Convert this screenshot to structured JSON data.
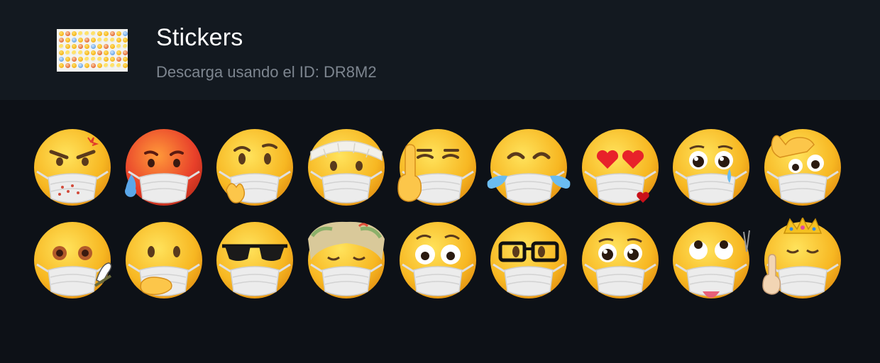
{
  "pack": {
    "title": "Stickers",
    "subtitle": "Descarga usando el ID: DR8M2",
    "thumbnail_icon": "sticker-sheet-thumbnail"
  },
  "colors": {
    "background": "#0d1117",
    "header_background": "#131920",
    "title": "#ffffff",
    "subtitle": "#7d858f",
    "face": "#f7b722",
    "mask": "#eeeeee"
  },
  "stickers": [
    {
      "icon": "angry-face-masked-icon",
      "variant": "angry"
    },
    {
      "icon": "hot-sweat-face-masked-icon",
      "variant": "hot"
    },
    {
      "icon": "thinking-face-masked-icon",
      "variant": "thinking"
    },
    {
      "icon": "bandage-face-masked-icon",
      "variant": "bandage"
    },
    {
      "icon": "middle-finger-face-masked-icon",
      "variant": "middlefinger"
    },
    {
      "icon": "crying-laughing-face-masked-icon",
      "variant": "tears"
    },
    {
      "icon": "heart-eyes-face-masked-icon",
      "variant": "hearts"
    },
    {
      "icon": "pleading-teary-face-masked-icon",
      "variant": "pleading-tear"
    },
    {
      "icon": "facepalm-face-masked-icon",
      "variant": "facepalm"
    },
    {
      "icon": "stoned-face-masked-icon",
      "variant": "stoned"
    },
    {
      "icon": "hand-over-mouth-face-masked-icon",
      "variant": "handmouth"
    },
    {
      "icon": "sunglasses-face-masked-icon",
      "variant": "sunglasses"
    },
    {
      "icon": "girl-hair-face-masked-icon",
      "variant": "hair"
    },
    {
      "icon": "flushed-face-masked-icon",
      "variant": "flushed"
    },
    {
      "icon": "nerd-glasses-face-masked-icon",
      "variant": "glasses"
    },
    {
      "icon": "pleading-face-masked-icon",
      "variant": "pleading"
    },
    {
      "icon": "rolling-eyes-tongue-face-masked-icon",
      "variant": "rolling"
    },
    {
      "icon": "crown-face-masked-icon",
      "variant": "crown"
    }
  ]
}
